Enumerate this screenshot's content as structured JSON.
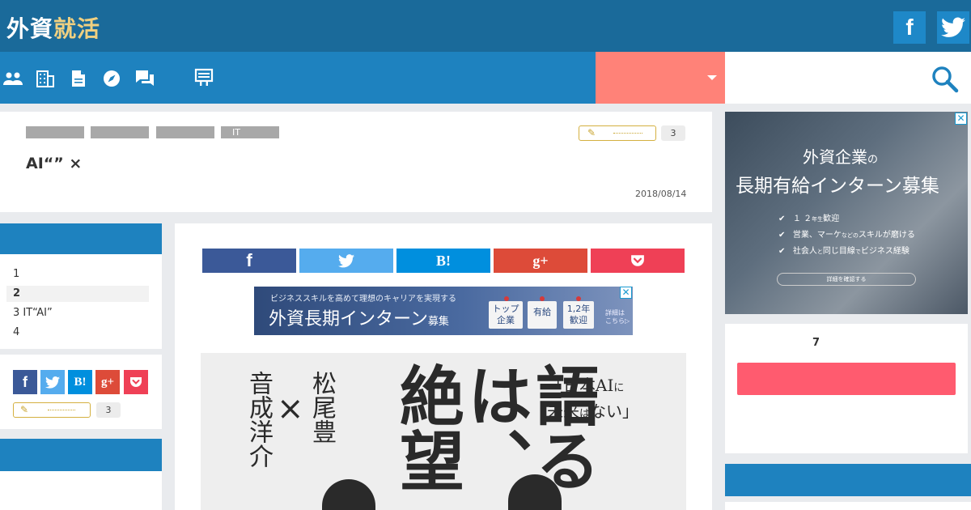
{
  "header": {
    "logo_part1": "外資",
    "logo_part2": "就活",
    "facebook_icon": "facebook-icon",
    "twitter_icon": "twitter-icon"
  },
  "nav": {
    "icons": [
      "people-icon",
      "building-icon",
      "document-icon",
      "compass-icon",
      "chat-icon",
      "board-icon"
    ],
    "dropdown_icon": "caret-down-icon",
    "search_icon": "search-icon"
  },
  "article": {
    "tags": [
      "",
      "",
      "",
      "IT"
    ],
    "clip_count": "3",
    "title": "AI“” ×",
    "date": "2018/08/14"
  },
  "toc": {
    "items": [
      "1",
      "2",
      "3 IT“AI”",
      "4"
    ]
  },
  "sidebar_share": {
    "buttons": [
      "f",
      "t",
      "B!",
      "g+",
      "pocket"
    ],
    "clip_count": "3"
  },
  "share_bar": {
    "hatena_label": "B!",
    "googleplus_label": "g+"
  },
  "banner_top": {
    "top_line": "ビジネススキルを高めて理想のキャリアを実現する",
    "main_text": "外資長期インターン",
    "main_suffix": "募集",
    "pills": [
      "トップ\n企業",
      "有給",
      "1,2年\n歓迎"
    ],
    "more_text": "詳細は\nこちら▷",
    "close_label": "✕"
  },
  "hero": {
    "big_vertical": "語るは、絶望",
    "name1": "松尾豊",
    "name2": "音成洋介",
    "times": "×",
    "quote_line1": "「日本AI",
    "quote_small1": "に",
    "quote_line2": "未来",
    "quote_small2": "は",
    "quote_line3": "ない」"
  },
  "ad_right": {
    "line1": "外資企業",
    "line1_small": "の",
    "line2": "長期有給インターン募集",
    "checks": [
      {
        "main": "１ ２",
        "small": "年生",
        "tail": "歓迎"
      },
      {
        "main": "営業、マーケ",
        "small": "などの",
        "tail": "スキルが磨ける"
      },
      {
        "main": "社会人",
        "small": "と",
        "tail": "同じ目線",
        "small2": "で",
        "tail2": "ビジネス経験"
      }
    ],
    "button": "詳細を確認する",
    "close_label": "✕"
  },
  "ranking": {
    "number": "7"
  }
}
